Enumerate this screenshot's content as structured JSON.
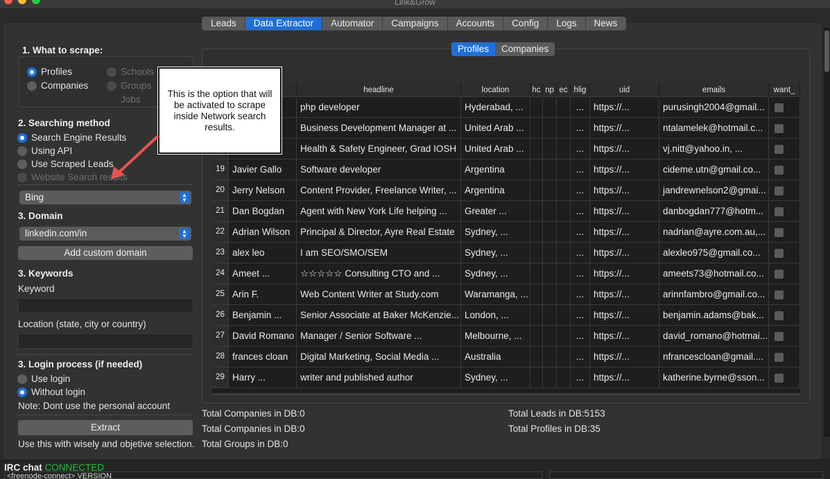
{
  "window": {
    "title": "Link&Grow"
  },
  "main_tabs": [
    {
      "label": "Leads",
      "active": false
    },
    {
      "label": "Data Extractor",
      "active": true
    },
    {
      "label": "Automator",
      "active": false
    },
    {
      "label": "Campaigns",
      "active": false
    },
    {
      "label": "Accounts",
      "active": false
    },
    {
      "label": "Config",
      "active": false
    },
    {
      "label": "Logs",
      "active": false
    },
    {
      "label": "News",
      "active": false
    }
  ],
  "sidebar": {
    "what_to_scrape": {
      "title": "1. What to scrape:",
      "options": [
        {
          "label": "Profiles",
          "checked": true,
          "enabled": true
        },
        {
          "label": "Companies",
          "checked": false,
          "enabled": true
        },
        {
          "label": "Schools",
          "checked": false,
          "enabled": false
        },
        {
          "label": "Groups",
          "checked": false,
          "enabled": false
        },
        {
          "label": "Jobs",
          "checked": false,
          "enabled": false
        }
      ]
    },
    "searching_method": {
      "title": "2. Searching method",
      "options": [
        {
          "label": "Search Engine Results",
          "checked": true,
          "enabled": true
        },
        {
          "label": "Using API",
          "checked": false,
          "enabled": true
        },
        {
          "label": "Use Scraped Leads",
          "checked": false,
          "enabled": true
        },
        {
          "label": "Website Search results",
          "checked": false,
          "enabled": false
        }
      ],
      "engine_select": "Bing"
    },
    "domain": {
      "title": "3. Domain",
      "select": "linkedin.com/in",
      "add_button": "Add custom domain"
    },
    "keywords": {
      "title": "3. Keywords",
      "keyword_label": "Keyword",
      "keyword_value": "",
      "location_label": "Location (state, city or country)",
      "location_value": ""
    },
    "login": {
      "title": "3. Login process (if needed)",
      "options": [
        {
          "label": "Use login",
          "checked": false
        },
        {
          "label": "Without login",
          "checked": true
        }
      ],
      "note": "Note: Dont use the personal account"
    },
    "extract_button": "Extract",
    "footer_note": "Use this with wisely and objetive selection."
  },
  "sub_tabs": [
    {
      "label": "Profiles",
      "active": true
    },
    {
      "label": "Companies",
      "active": false
    }
  ],
  "table": {
    "columns": [
      "",
      "",
      "headline",
      "location",
      "hc",
      "np",
      "ec",
      "hlig",
      "uid",
      "emails",
      "want_"
    ],
    "rows": [
      {
        "num": "",
        "name": "",
        "headline": "php developer",
        "location": "Hyderabad, ...",
        "hc": "",
        "np": "",
        "ec": "",
        "hl": "...",
        "uid": "https://...",
        "email": "purusingh2004@gmail..."
      },
      {
        "num": "",
        "name": "",
        "headline": "Business Development Manager at ...",
        "location": "United Arab ...",
        "hc": "",
        "np": "",
        "ec": "",
        "hl": "...",
        "uid": "https://...",
        "email": "ntalamelek@hotmail.c..."
      },
      {
        "num": "",
        "name": "",
        "headline": "Health & Safety Engineer, Grad IOSH",
        "location": "United Arab ...",
        "hc": "",
        "np": "",
        "ec": "",
        "hl": "...",
        "uid": "https://...",
        "email": "vj.nitt@yahoo.in, ..."
      },
      {
        "num": "19",
        "name": "Javier Gallo",
        "headline": "Software developer",
        "location": "Argentina",
        "hc": "",
        "np": "",
        "ec": "",
        "hl": "...",
        "uid": "https://...",
        "email": "cideme.utn@gmail.co..."
      },
      {
        "num": "20",
        "name": "Jerry Nelson",
        "headline": "Content Provider, Freelance Writer, ...",
        "location": "Argentina",
        "hc": "",
        "np": "",
        "ec": "",
        "hl": "...",
        "uid": "https://...",
        "email": "jandrewnelson2@gmai..."
      },
      {
        "num": "21",
        "name": "Dan Bogdan",
        "headline": "Agent with New York Life helping ...",
        "location": "Greater ...",
        "hc": "",
        "np": "",
        "ec": "",
        "hl": "...",
        "uid": "https://...",
        "email": "danbogdan777@hotm..."
      },
      {
        "num": "22",
        "name": "Adrian Wilson",
        "headline": "Principal & Director, Ayre Real Estate",
        "location": "Sydney, ...",
        "hc": "",
        "np": "",
        "ec": "",
        "hl": "...",
        "uid": "https://...",
        "email": "nadrian@ayre.com.au,..."
      },
      {
        "num": "23",
        "name": "alex leo",
        "headline": "I am SEO/SMO/SEM",
        "location": "Sydney, ...",
        "hc": "",
        "np": "",
        "ec": "",
        "hl": "...",
        "uid": "https://...",
        "email": "alexleo975@gmail.co..."
      },
      {
        "num": "24",
        "name": "Ameet ...",
        "headline": "☆☆☆☆☆ Consulting CTO and ...",
        "location": "Sydney, ...",
        "hc": "",
        "np": "",
        "ec": "",
        "hl": "...",
        "uid": "https://...",
        "email": "ameets73@hotmail.co..."
      },
      {
        "num": "25",
        "name": "Arin F.",
        "headline": "Web Content Writer at Study.com",
        "location": "Waramanga, ...",
        "hc": "",
        "np": "",
        "ec": "",
        "hl": "...",
        "uid": "https://...",
        "email": "arinnfambro@gmail.co..."
      },
      {
        "num": "26",
        "name": "Benjamin ...",
        "headline": "Senior Associate at Baker McKenzie...",
        "location": "London, ...",
        "hc": "",
        "np": "",
        "ec": "",
        "hl": "...",
        "uid": "https://...",
        "email": "benjamin.adams@bak..."
      },
      {
        "num": "27",
        "name": "David Romano",
        "headline": "Manager / Senior Software ...",
        "location": "Melbourne, ...",
        "hc": "",
        "np": "",
        "ec": "",
        "hl": "...",
        "uid": "https://...",
        "email": "david_romano@hotmai..."
      },
      {
        "num": "28",
        "name": "frances cloan",
        "headline": "Digital Marketing, Social Media ...",
        "location": "Australia",
        "hc": "",
        "np": "",
        "ec": "",
        "hl": "...",
        "uid": "https://...",
        "email": "nfrancescloan@gmail...."
      },
      {
        "num": "29",
        "name": "Harry ...",
        "headline": "writer and published author",
        "location": "Sydney, ...",
        "hc": "",
        "np": "",
        "ec": "",
        "hl": "...",
        "uid": "https://...",
        "email": "katherine.byrne@sson..."
      }
    ]
  },
  "stats": {
    "companies_1": "Total Companies in DB:0",
    "companies_2": "Total Companies in DB:0",
    "groups": "Total Groups in DB:0",
    "leads": "Total Leads in DB:5153",
    "profiles": "Total Profiles in DB:35"
  },
  "callout": {
    "text": "This is the option that will be activated to scrape inside Network search results."
  },
  "irc": {
    "label": "IRC chat",
    "status": "CONNECTED",
    "line": "<freenode-connect> VERSION"
  },
  "colors": {
    "accent": "#1e6fd9",
    "connected": "#22c03a",
    "arrow": "#e5554f"
  }
}
